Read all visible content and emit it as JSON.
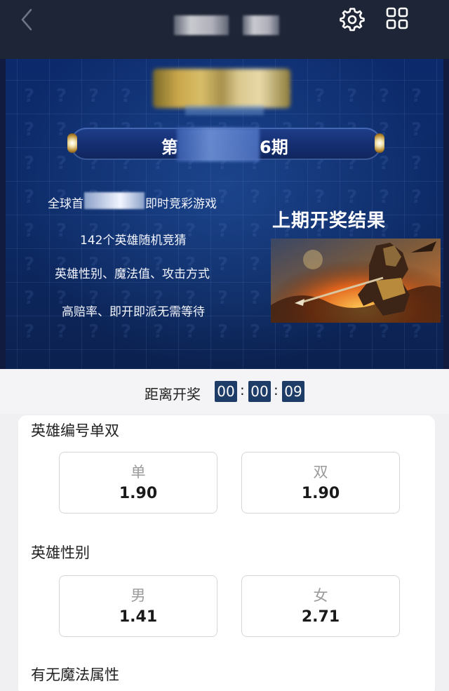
{
  "header": {
    "back_icon": "chevron-left-icon",
    "settings_icon": "gear-icon",
    "grid_icon": "grid-icon"
  },
  "banner": {
    "period_prefix": "第",
    "period_suffix": "6期",
    "features": {
      "line1_prefix": "全球首",
      "line1_suffix": "即时竞彩游戏",
      "line2": "142个英雄随机竞猜",
      "line3": "英雄性别、魔法值、攻击方式",
      "line4": "高赔率、即开即派无需等待"
    },
    "last_result_title": "上期开奖结果"
  },
  "countdown": {
    "label": "距离开奖",
    "hours": "00",
    "minutes": "00",
    "seconds": "09"
  },
  "sections": {
    "odd_even": {
      "title": "英雄编号单双",
      "options": [
        {
          "name": "单",
          "odds": "1.90"
        },
        {
          "name": "双",
          "odds": "1.90"
        }
      ]
    },
    "gender": {
      "title": "英雄性别",
      "options": [
        {
          "name": "男",
          "odds": "1.41"
        },
        {
          "name": "女",
          "odds": "2.71"
        }
      ]
    },
    "magic": {
      "title": "有无魔法属性"
    }
  },
  "colors": {
    "topbar": "#1e2536",
    "banner": "#0c2a6b",
    "countdown_box": "#1e3c68"
  }
}
